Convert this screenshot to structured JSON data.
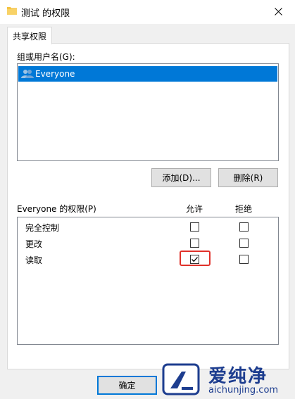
{
  "window": {
    "title": "测试 的权限",
    "icons": {
      "title": "folder-icon",
      "close": "close-icon"
    }
  },
  "tabs": [
    {
      "label": "共享权限",
      "active": true
    }
  ],
  "groups": {
    "label": "组或用户名(G):",
    "items": [
      {
        "name": "Everyone",
        "icon": "users-icon",
        "selected": true
      }
    ],
    "add_label": "添加(D)...",
    "remove_label": "删除(R)"
  },
  "permissions": {
    "header_label": "Everyone 的权限(P)",
    "allow_header": "允许",
    "deny_header": "拒绝",
    "rows": [
      {
        "label": "完全控制",
        "allow": false,
        "deny": false
      },
      {
        "label": "更改",
        "allow": false,
        "deny": false
      },
      {
        "label": "读取",
        "allow": true,
        "deny": false
      }
    ]
  },
  "footer": {
    "ok_label": "确定"
  },
  "watermark": {
    "title": "爱纯净",
    "url": "aichunjing.com"
  },
  "colors": {
    "selection": "#0078d7",
    "highlight_border": "#e0312a",
    "watermark": "#1d3d8f",
    "folder": "#f5c342"
  }
}
